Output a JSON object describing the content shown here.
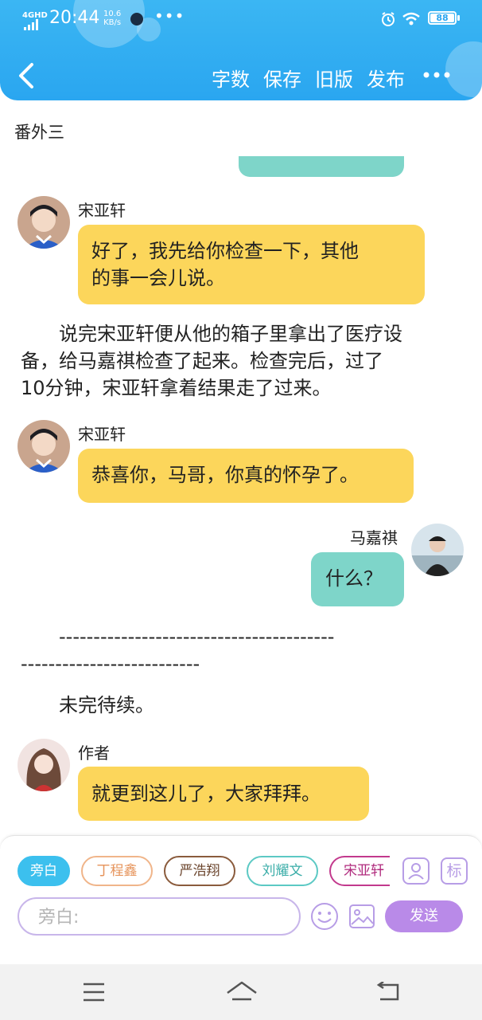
{
  "status_bar": {
    "signal": "4GHD",
    "time": "20:44",
    "speed_value": "10.6",
    "speed_unit": "KB/s",
    "more_dots": "•••",
    "battery": "88"
  },
  "header": {
    "actions": [
      "字数",
      "保存",
      "旧版",
      "发布"
    ]
  },
  "chapter_title": "番外三",
  "messages": [
    {
      "speaker": "宋亚轩",
      "text_lines": [
        "好了，我先给你检查一下，其他",
        "的事一会儿说。"
      ]
    },
    {
      "speaker": "宋亚轩",
      "text": "恭喜你，马哥，你真的怀孕了。"
    },
    {
      "speaker": "马嘉祺",
      "text": "什么？"
    },
    {
      "speaker": "作者",
      "text": "就更到这儿了，大家拜拜。"
    }
  ],
  "narration": {
    "para1_lines": [
      "　　说完宋亚轩便从他的箱子里拿出了医疗设",
      "备，给马嘉祺检查了起来。检查完后，过了",
      "10分钟，宋亚轩拿着结果走了过来。"
    ],
    "divider_lines": [
      "　　----------------------------------------",
      "--------------------------"
    ],
    "para2": "　　未完待续。"
  },
  "composer": {
    "roles": [
      {
        "label": "旁白",
        "color": "#3cc0ee",
        "selected": true
      },
      {
        "label": "丁程鑫",
        "color": "#f0b58a",
        "selected": false
      },
      {
        "label": "严浩翔",
        "color": "#8a5b3c",
        "selected": false
      },
      {
        "label": "刘耀文",
        "color": "#5cc9c4",
        "selected": false
      },
      {
        "label": "宋亚轩",
        "color": "#c2398d",
        "selected": false
      }
    ],
    "mark_label": "标",
    "input_placeholder": "旁白:",
    "send_label": "发送"
  }
}
